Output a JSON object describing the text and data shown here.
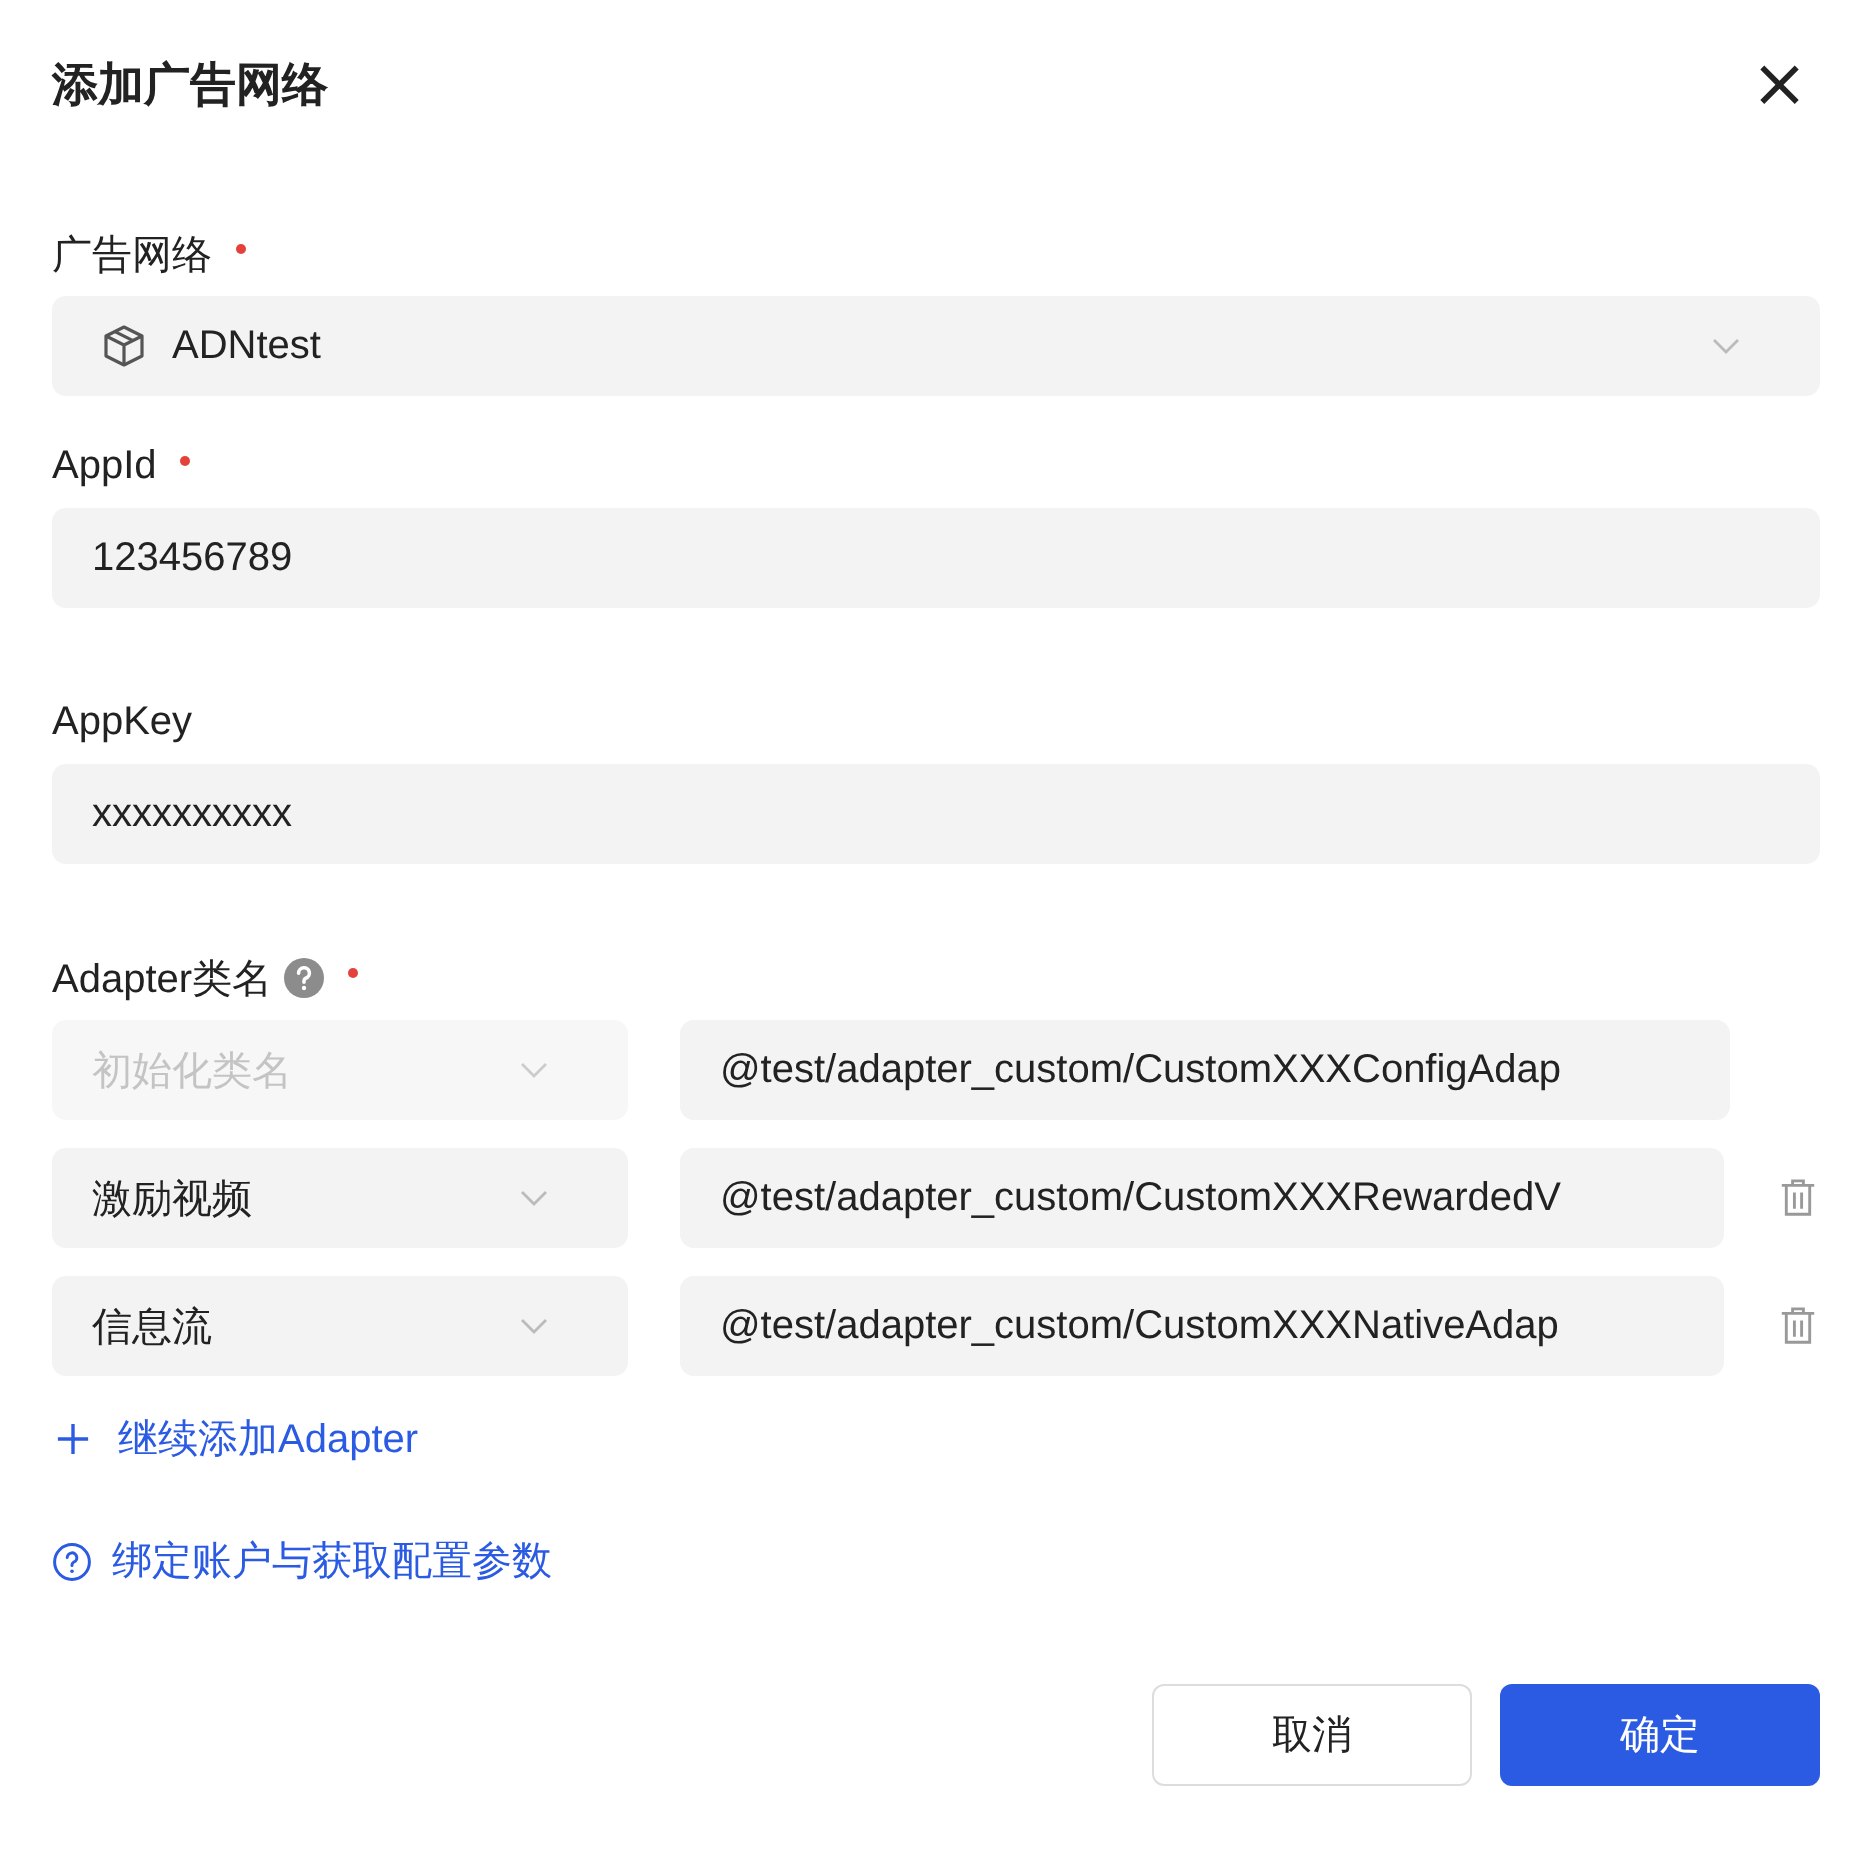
{
  "dialog": {
    "title": "添加广告网络",
    "close": "×"
  },
  "network": {
    "label": "广告网络",
    "required": true,
    "value": "ADNtest"
  },
  "appid": {
    "label": "AppId",
    "required": true,
    "value": "123456789"
  },
  "appkey": {
    "label": "AppKey",
    "value": "xxxxxxxxxx"
  },
  "adapters": {
    "label": "Adapter类名",
    "required": true,
    "rows": [
      {
        "type": {
          "placeholder": "初始化类名",
          "disabled": true
        },
        "class_name": "@test/adapter_custom/CustomXXXConfigAdap",
        "deletable": false
      },
      {
        "type": {
          "value": "激励视频",
          "disabled": false
        },
        "class_name": "@test/adapter_custom/CustomXXXRewardedV",
        "deletable": true
      },
      {
        "type": {
          "value": "信息流",
          "disabled": false
        },
        "class_name": "@test/adapter_custom/CustomXXXNativeAdap",
        "deletable": true
      }
    ]
  },
  "add_link": "继续添加Adapter",
  "help_link": "绑定账户与获取配置参数",
  "buttons": [
    {
      "label": "取消",
      "kind": "secondary"
    },
    {
      "label": "确定",
      "kind": "primary"
    }
  ]
}
